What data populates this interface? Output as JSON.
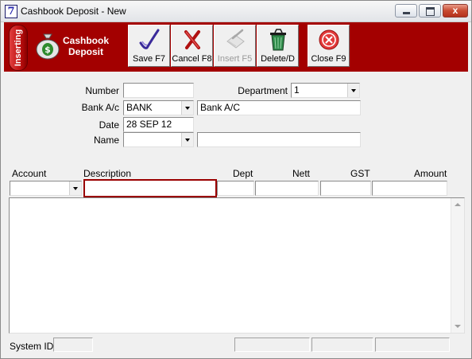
{
  "window": {
    "title": "Cashbook Deposit - New",
    "app_icon_glyph": "7",
    "close_glyph": "x"
  },
  "band": {
    "mode_badge": "Inserting",
    "title_line1": "Cashbook",
    "title_line2": "Deposit",
    "background": "#a30000"
  },
  "toolbar": {
    "save_label": "Save F7",
    "cancel_label": "Cancel F8",
    "insert_label": "Insert F5",
    "delete_label": "Delete/D",
    "close_label": "Close F9",
    "insert_enabled": false
  },
  "form": {
    "number_label": "Number",
    "number_value": "",
    "department_label": "Department",
    "department_value": "1",
    "bank_label": "Bank A/c",
    "bank_code": "BANK",
    "bank_name": "Bank A/C",
    "date_label": "Date",
    "date_value": "28 SEP 12",
    "name_label": "Name",
    "name_code": "",
    "name_value": ""
  },
  "grid": {
    "columns": [
      "Account",
      "Description",
      "Dept",
      "Nett",
      "GST",
      "Amount"
    ],
    "entry": {
      "account": "",
      "description": "",
      "dept": "",
      "nett": "",
      "gst": "",
      "amount": ""
    },
    "rows": []
  },
  "status": {
    "system_id_label": "System ID",
    "system_id_value": ""
  },
  "icons": [
    "app-icon",
    "moneybag-icon",
    "pen-check-icon",
    "red-x-icon",
    "insert-icon",
    "recycle-bin-icon",
    "close-circle-icon"
  ]
}
